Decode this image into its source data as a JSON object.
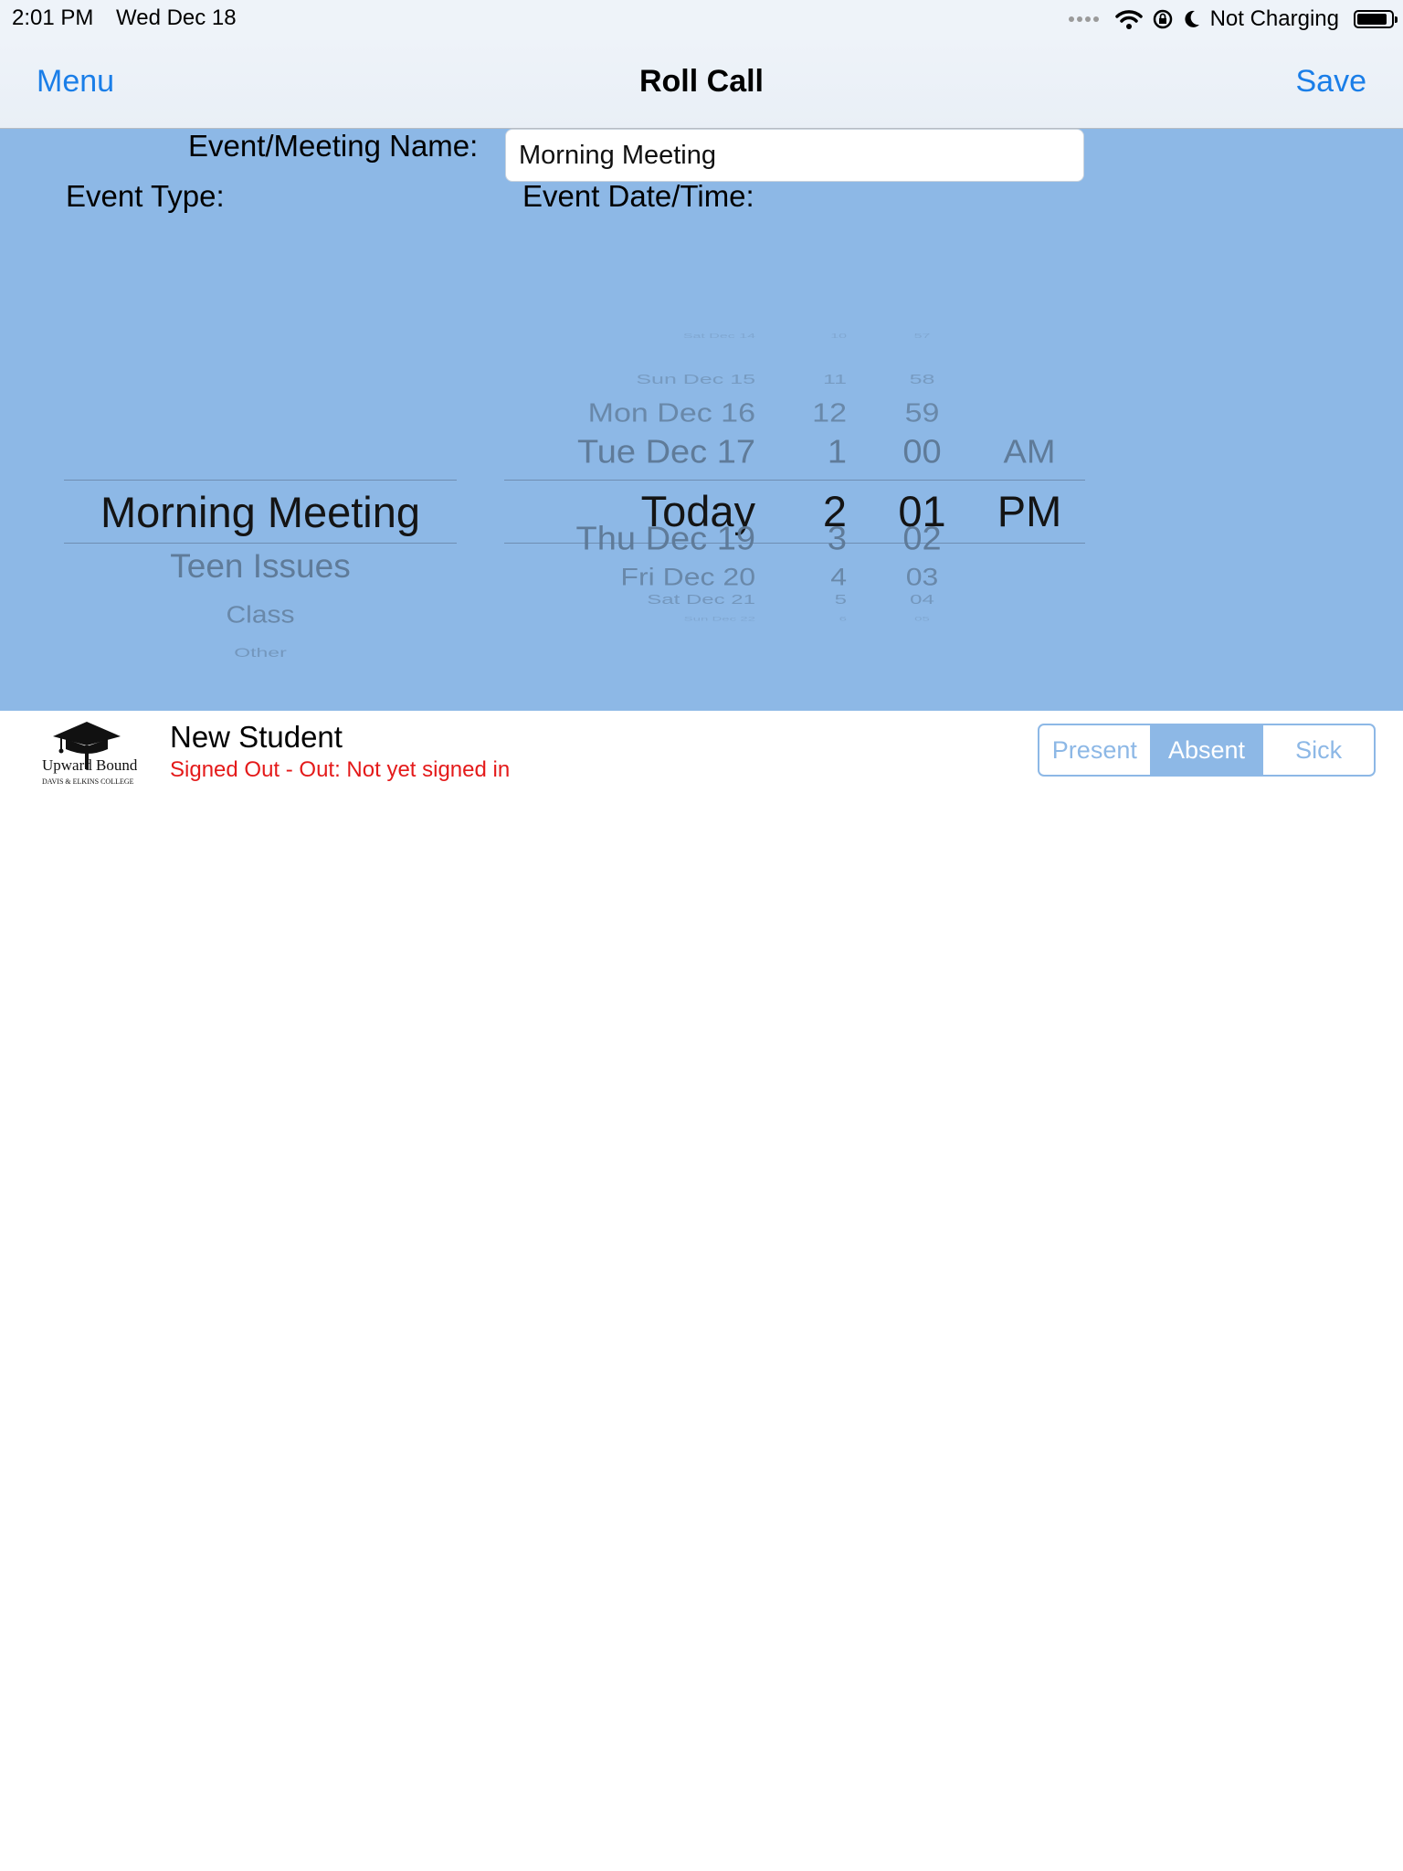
{
  "status_bar": {
    "time": "2:01 PM",
    "date": "Wed Dec 18",
    "battery_text": "Not Charging",
    "icons": [
      "signal-dots-icon",
      "wifi-icon",
      "rotation-lock-icon",
      "moon-icon",
      "battery-icon"
    ]
  },
  "nav": {
    "left": "Menu",
    "title": "Roll Call",
    "right": "Save",
    "accent": "#1a7ee8"
  },
  "form": {
    "name_label": "Event/Meeting Name:",
    "name_value": "Morning Meeting",
    "type_label": "Event Type:",
    "date_label": "Event Date/Time:",
    "panel_color": "#8db8e6"
  },
  "type_picker": {
    "selected": "Morning Meeting",
    "above": [],
    "below": [
      "Teen Issues",
      "Class",
      "Other"
    ]
  },
  "date_picker": {
    "days": [
      "Sat Dec 14",
      "Sun Dec 15",
      "Mon Dec 16",
      "Tue Dec 17",
      "Today",
      "Thu Dec 19",
      "Fri Dec 20",
      "Sat Dec 21",
      "Sun Dec 22"
    ],
    "hours": [
      "10",
      "11",
      "12",
      "1",
      "2",
      "3",
      "4",
      "5",
      "6"
    ],
    "minutes": [
      "57",
      "58",
      "59",
      "00",
      "01",
      "02",
      "03",
      "04",
      "05"
    ],
    "ampm": [
      "AM",
      "PM"
    ],
    "selected_index": 4
  },
  "student": {
    "logo_text": "Upward Bound",
    "logo_subtext": "DAVIS & ELKINS COLLEGE",
    "name": "New Student",
    "status": "Signed Out - Out: Not yet signed in",
    "status_color": "#e41a1a",
    "segments": [
      "Present",
      "Absent",
      "Sick"
    ],
    "selected_segment": "Absent"
  }
}
